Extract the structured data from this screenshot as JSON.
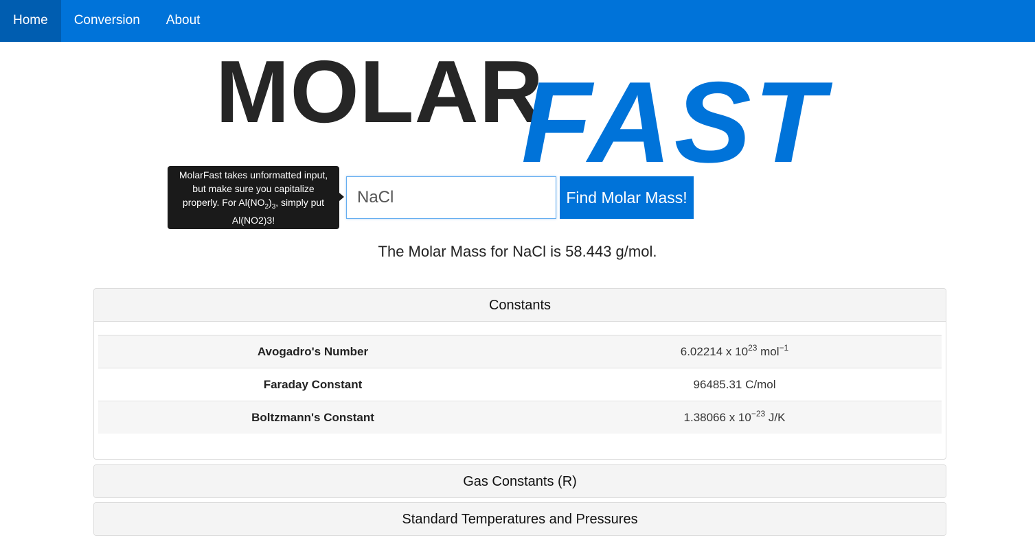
{
  "nav": {
    "items": [
      {
        "label": "Home",
        "active": true
      },
      {
        "label": "Conversion",
        "active": false
      },
      {
        "label": "About",
        "active": false
      }
    ]
  },
  "logo": {
    "part1": "MOLAR",
    "part2": "FAST"
  },
  "tooltip": {
    "text_a": "MolarFast takes unformatted input, but make sure you capitalize properly. For Al(NO",
    "sub_a": "2",
    "text_b": ")",
    "sub_b": "3",
    "text_c": ", simply put Al(NO2)3!"
  },
  "search": {
    "value": "NaCl",
    "button_label": "Find Molar Mass!"
  },
  "result": {
    "text": "The Molar Mass for NaCl is 58.443 g/mol."
  },
  "panels": {
    "constants": {
      "title": "Constants",
      "rows": [
        {
          "name": "Avogadro's Number",
          "mantissa": "6.02214 x 10",
          "exponent": "23",
          "unit": " mol",
          "unit_exp": "−1"
        },
        {
          "name": "Faraday Constant",
          "mantissa": "96485.31 C/mol",
          "exponent": "",
          "unit": "",
          "unit_exp": ""
        },
        {
          "name": "Boltzmann's Constant",
          "mantissa": "1.38066 x 10",
          "exponent": "−23",
          "unit": " J/K",
          "unit_exp": ""
        }
      ]
    },
    "gas_constants": {
      "title": "Gas Constants (R)"
    },
    "stp": {
      "title": "Standard Temperatures and Pressures"
    }
  },
  "colors": {
    "brand": "#0073d9",
    "nav_active": "#005db0",
    "tooltip_bg": "#1a1a1a"
  }
}
